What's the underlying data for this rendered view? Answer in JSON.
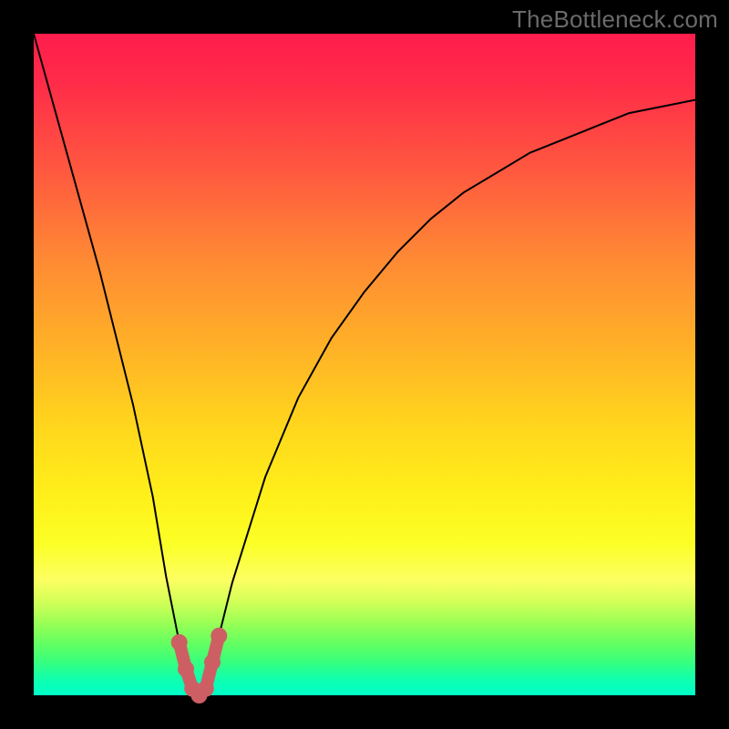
{
  "watermark": "TheBottleneck.com",
  "colors": {
    "background": "#000000",
    "curve": "#000000",
    "highlight": "#cd5f64",
    "watermark": "#6a6a6a"
  },
  "chart_data": {
    "type": "line",
    "title": "",
    "xlabel": "",
    "ylabel": "",
    "xlim": [
      0,
      100
    ],
    "ylim": [
      0,
      100
    ],
    "grid": false,
    "legend": false,
    "series": [
      {
        "name": "bottleneck-curve",
        "x": [
          0,
          5,
          10,
          15,
          18,
          20,
          22,
          24,
          25,
          26,
          28,
          30,
          35,
          40,
          45,
          50,
          55,
          60,
          65,
          70,
          75,
          80,
          85,
          90,
          95,
          100
        ],
        "values": [
          100,
          82,
          64,
          44,
          30,
          18,
          8,
          1,
          0,
          1,
          9,
          17,
          33,
          45,
          54,
          61,
          67,
          72,
          76,
          79,
          82,
          84,
          86,
          88,
          89,
          90
        ]
      }
    ],
    "highlight": {
      "center_x": 25,
      "points_x": [
        22,
        23,
        24,
        25,
        26,
        27,
        28
      ],
      "points_y": [
        8,
        4,
        1,
        0,
        1,
        5,
        9
      ]
    },
    "notes": "Values are estimates read from an unlabeled heat-gradient chart (no axis ticks visible). x is horizontal position (0=left edge of plot, 100=right edge). values is vertical position of the curve as percentage of plot height from the bottom (0=bottom, 100=top). The curve reaches its minimum near x≈25."
  }
}
